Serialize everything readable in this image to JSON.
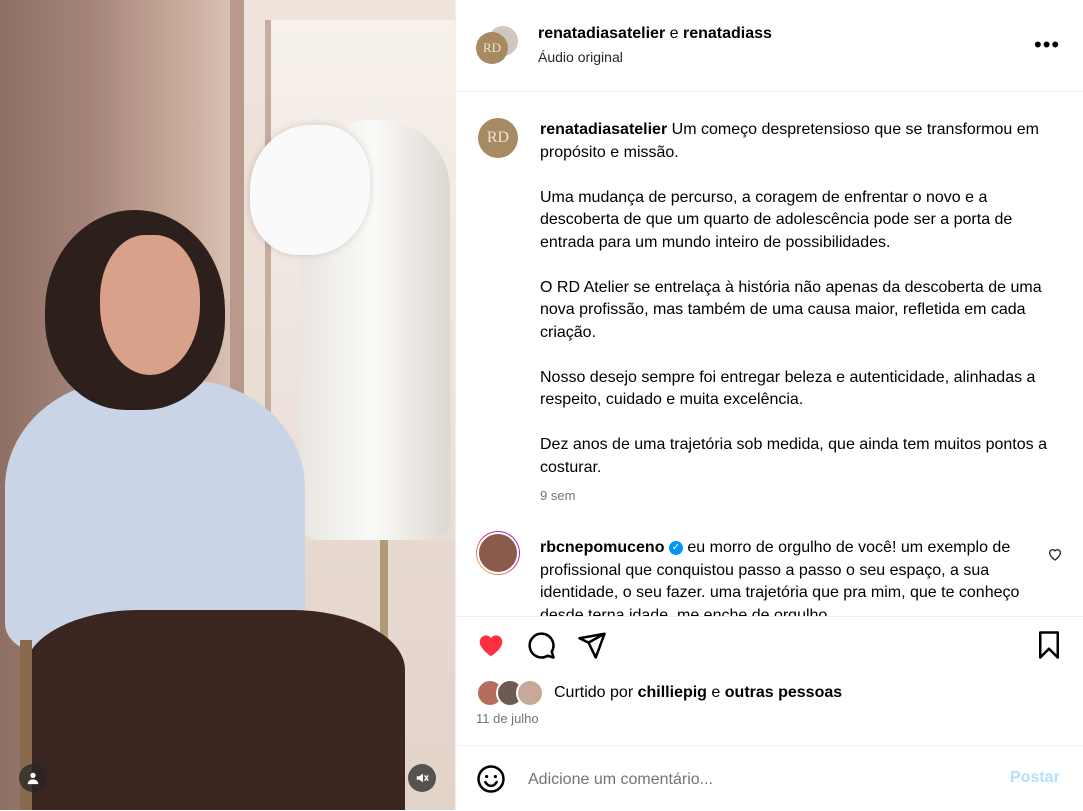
{
  "post": {
    "header": {
      "author": "renatadiasatelier",
      "connector": "e",
      "coauthor": "renatadiass",
      "audio": "Áudio original",
      "avatar_initials": "RD"
    },
    "caption": {
      "author": "renatadiasatelier",
      "avatar_initials": "RD",
      "paragraphs": [
        "Um começo despretensioso que se transformou em propósito e missão.",
        "Uma mudança de percurso, a coragem de enfrentar o novo e a descoberta de que um quarto de adolescência pode ser a porta de entrada para um mundo inteiro de possibilidades.",
        "O RD Atelier se entrelaça à história não apenas da descoberta de uma nova profissão, mas também de uma causa maior, refletida em cada criação.",
        "Nosso desejo sempre foi entregar beleza e autenticidade, alinhadas a respeito, cuidado e muita excelência.",
        "Dez anos de uma trajetória sob medida, que ainda tem muitos pontos a costurar."
      ],
      "time": "9 sem"
    },
    "comment": {
      "author": "rbcnepomuceno",
      "text": "eu morro de orgulho de você! um exemplo de profissional que conquistou passo a passo o seu espaço, a sua identidade, o seu fazer. uma trajetória que pra mim, que te conheço desde terna idade, me enche de orgulho"
    },
    "likes": {
      "prefix": "Curtido por",
      "user": "chilliepig",
      "connector": "e",
      "others": "outras pessoas"
    },
    "date": "11 de julho",
    "comment_input": {
      "placeholder": "Adicione um comentário..."
    },
    "post_button": "Postar",
    "colors": {
      "like_red": "#ff3040",
      "post_blue_disabled": "#b2dffc",
      "verified_blue": "#0095f6"
    }
  }
}
